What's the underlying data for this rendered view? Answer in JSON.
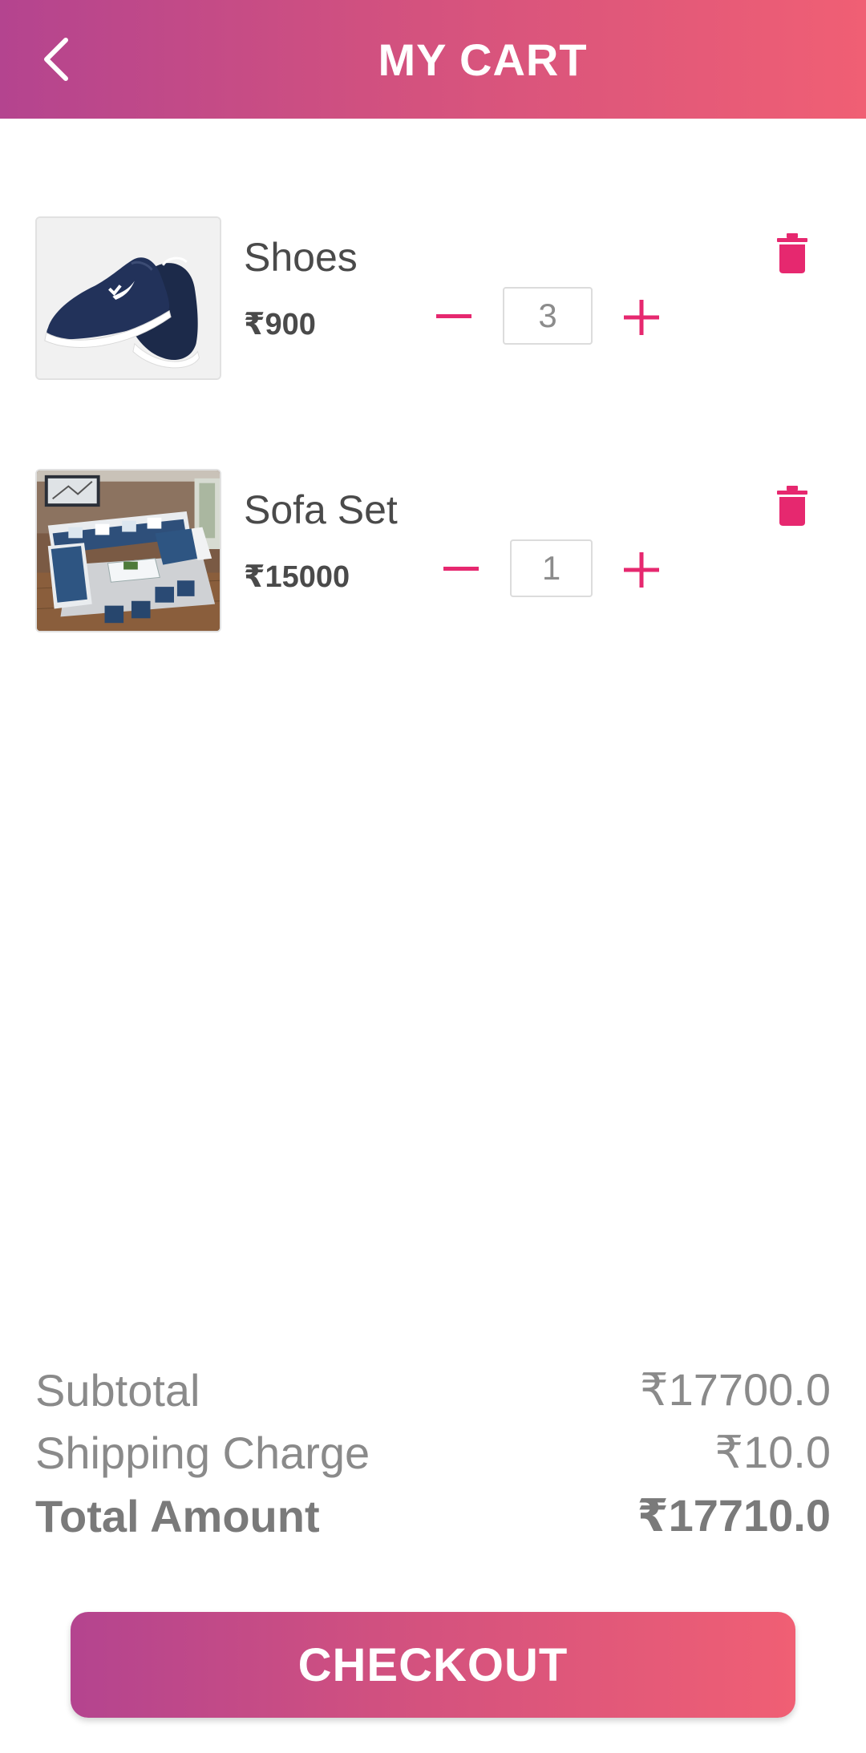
{
  "header": {
    "title": "MY CART",
    "back_icon": "chevron-left-icon"
  },
  "cart": {
    "items": [
      {
        "name": "Shoes",
        "price": "₹900",
        "quantity": "3",
        "image": "sneakers-photo",
        "minus_icon": "minus-icon",
        "plus_icon": "plus-icon",
        "delete_icon": "trash-icon"
      },
      {
        "name": "Sofa Set",
        "price": "₹15000",
        "quantity": "1",
        "image": "sofa-set-photo",
        "minus_icon": "minus-icon",
        "plus_icon": "plus-icon",
        "delete_icon": "trash-icon"
      }
    ]
  },
  "summary": {
    "subtotal_label": "Subtotal",
    "subtotal_value": "₹17700.0",
    "shipping_label": "Shipping Charge",
    "shipping_value": "₹10.0",
    "total_label": "Total Amount",
    "total_value": "₹17710.0"
  },
  "checkout": {
    "label": "CHECKOUT"
  },
  "colors": {
    "accent": "#e6286f",
    "gradient_start": "#b4448f",
    "gradient_end": "#f05f74",
    "text_dark": "#4a4a4a",
    "text_muted": "#8a8a8a"
  }
}
